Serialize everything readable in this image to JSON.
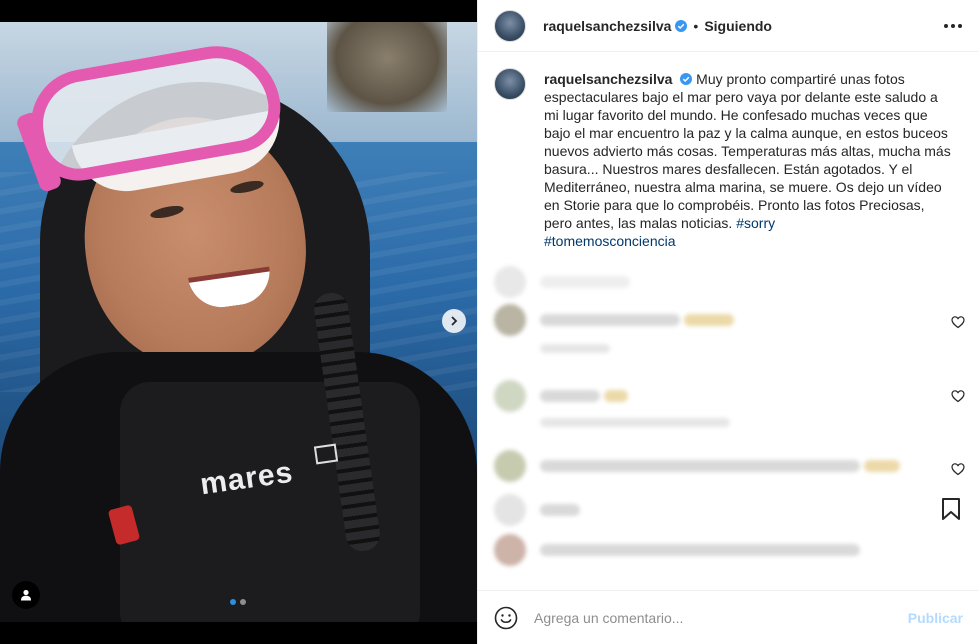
{
  "post": {
    "media_description": "",
    "carousel": {
      "count": 2,
      "active": 0
    }
  },
  "header": {
    "username": "raquelsanchezsilva",
    "separator": "•",
    "following_label": "Siguiendo",
    "more_icon": "more-horizontal-icon"
  },
  "caption": {
    "username": "raquelsanchezsilva",
    "text": " Muy pronto compartiré unas fotos espectaculares bajo el mar pero vaya por delante este saludo a mi lugar favorito del mundo. He confesado muchas veces que bajo el mar encuentro la paz y la calma aunque, en estos buceos nuevos advierto más cosas. Temperaturas más altas, mucha más basura... Nuestros mares desfallecen. Están agotados. Y el Mediterráneo, nuestra alma marina, se muere. Os dejo un vídeo en Storie para que lo comprobéis. Pronto las fotos Preciosas, pero antes, las malas noticias. ",
    "hashtags": [
      "#sorry",
      "#tomemosconciencia"
    ]
  },
  "comment_box": {
    "placeholder": "Agrega un comentario...",
    "publish_label": "Publicar"
  },
  "colors": {
    "verified": "#3897f0",
    "link": "#00376b",
    "publish_disabled": "#b3dbff",
    "text": "#262626"
  }
}
